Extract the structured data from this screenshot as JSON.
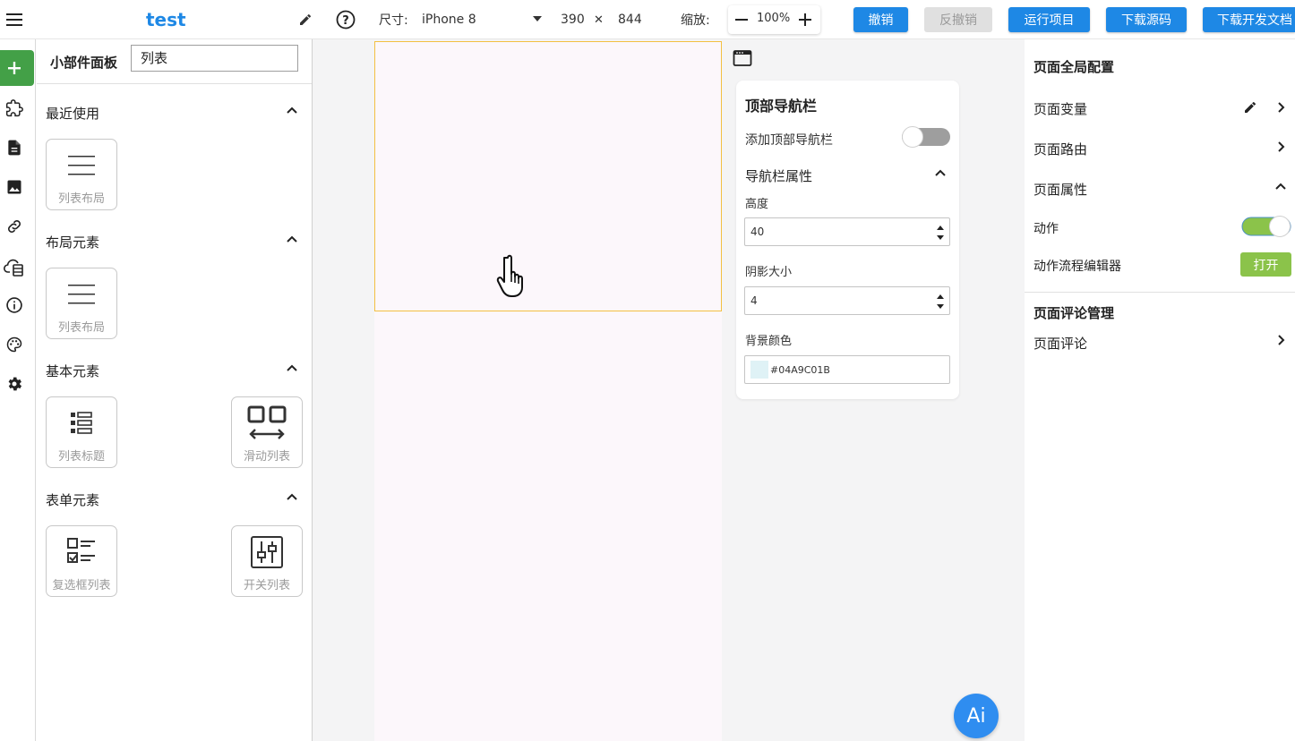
{
  "app": {
    "title": "test"
  },
  "toolbar": {
    "size_label": "尺寸:",
    "device": "iPhone 8",
    "width": "390",
    "times": "✕",
    "height": "844",
    "zoom_label": "缩放:",
    "zoom_value": "100%",
    "undo": "撤销",
    "redo": "反撤销",
    "run": "运行项目",
    "download_source": "下载源码",
    "download_dev": "下载开发文档"
  },
  "panel": {
    "title": "小部件面板",
    "search_value": "列表",
    "sections": [
      {
        "title": "最近使用",
        "cards": [
          {
            "label": "列表布局",
            "icon": "list-layout-icon"
          }
        ]
      },
      {
        "title": "布局元素",
        "cards": [
          {
            "label": "列表布局",
            "icon": "list-layout-icon"
          }
        ]
      },
      {
        "title": "基本元素",
        "cards": [
          {
            "label": "列表标题",
            "icon": "list-title-icon"
          },
          {
            "label": "滑动列表",
            "icon": "slide-list-icon"
          }
        ]
      },
      {
        "title": "表单元素",
        "cards": [
          {
            "label": "复选框列表",
            "icon": "checkbox-list-icon"
          },
          {
            "label": "开关列表",
            "icon": "switch-list-icon"
          }
        ]
      }
    ]
  },
  "navbar_card": {
    "title": "顶部导航栏",
    "add_label": "添加顶部导航栏",
    "add_enabled": false,
    "props_title": "导航栏属性",
    "height_label": "高度",
    "height_value": "40",
    "shadow_label": "阴影大小",
    "shadow_value": "4",
    "bg_label": "背景颜色",
    "bg_value": "#04A9C01B"
  },
  "ai_button": "Ai",
  "right": {
    "global_title": "页面全局配置",
    "variables": "页面变量",
    "routes": "页面路由",
    "props": "页面属性",
    "action": "动作",
    "action_enabled": true,
    "flow_editor": "动作流程编辑器",
    "open": "打开",
    "comments_title": "页面评论管理",
    "comments": "页面评论"
  },
  "colors": {
    "accent": "#1e88e5",
    "green": "#4caf50",
    "toggle_on": "#8bc34a",
    "selection": "#f3c042"
  }
}
